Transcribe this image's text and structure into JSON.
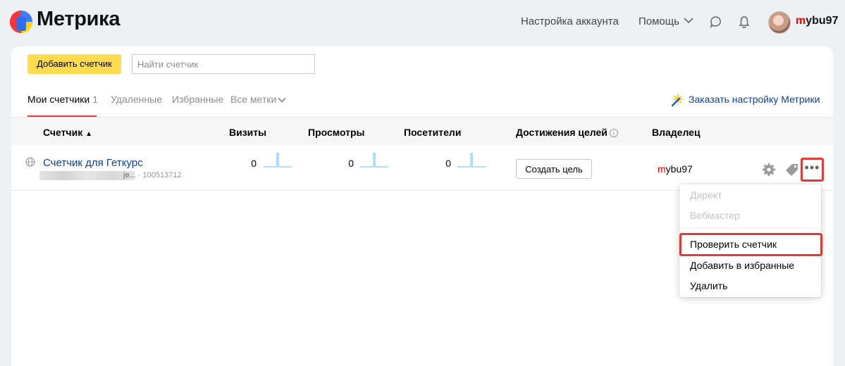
{
  "header": {
    "brand": "Метрика",
    "account_settings": "Настройка аккаунта",
    "help": "Помощь",
    "user_first_letter": "m",
    "user_rest": "ybu97"
  },
  "toolbar": {
    "add_counter": "Добавить счетчик",
    "search_placeholder": "Найти счетчик"
  },
  "tabs": [
    {
      "label": "Мои счетчики",
      "count": "1",
      "active": true
    },
    {
      "label": "Удаленные"
    },
    {
      "label": "Избранные"
    },
    {
      "label": "Все метки"
    }
  ],
  "order_setup": "Заказать настройку Метрики",
  "table": {
    "columns": {
      "counter": "Счетчик",
      "sort_arrow": "▲",
      "visits": "Визиты",
      "views": "Просмотры",
      "visitors": "Посетители",
      "goals": "Достижения целей",
      "owner": "Владелец"
    },
    "rows": [
      {
        "name": "Счетчик для Геткурс",
        "url_suffix": "je...",
        "id": "· 100513712",
        "visits": "0",
        "views": "0",
        "visitors": "0",
        "goal_button": "Создать цель",
        "owner_first_letter": "m",
        "owner_rest": "ybu97"
      }
    ]
  },
  "menu": {
    "items": [
      "Директ",
      "Вебмастер",
      "Проверить счетчик",
      "Добавить в избранные",
      "Удалить"
    ]
  },
  "colors": {
    "accent_yellow": "#ffdb4d",
    "link_blue": "#0c3ea8",
    "highlight_red": "#e53935",
    "sparkline": "#7fd0f0"
  }
}
